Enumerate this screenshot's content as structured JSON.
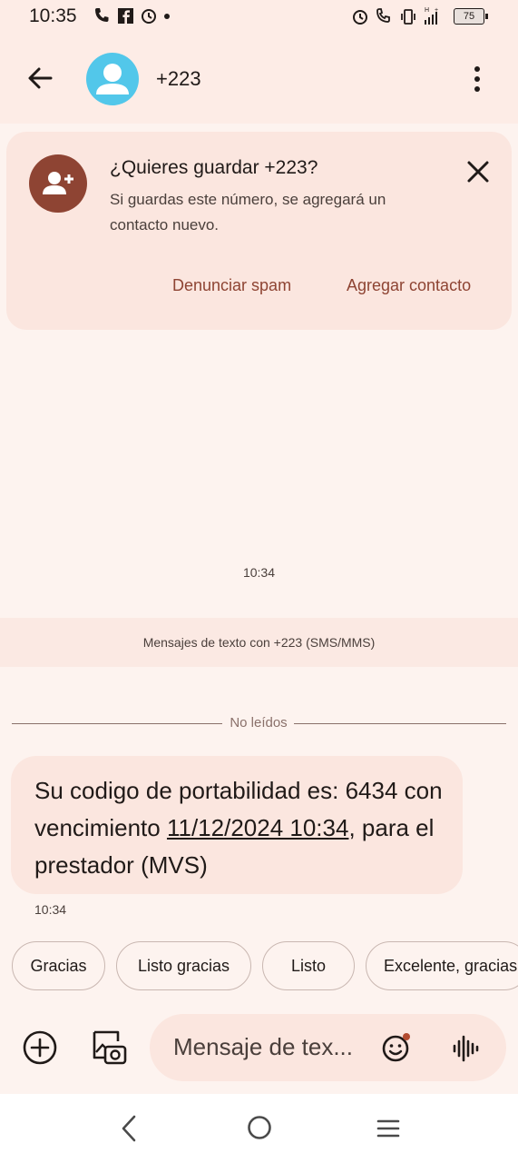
{
  "status_bar": {
    "time": "10:35",
    "battery": "75",
    "left_icons": [
      "phone-icon",
      "facebook-icon",
      "alarm-icon",
      "dot-icon"
    ],
    "right_icons": [
      "alarm-icon",
      "wifi-calling-icon",
      "vibrate-icon",
      "signal-icon",
      "battery-icon"
    ]
  },
  "app_bar": {
    "title": "+223",
    "back_icon": "arrow-back-icon",
    "more_icon": "more-vert-icon"
  },
  "save_card": {
    "title": "¿Quieres guardar +223?",
    "body": "Si guardas este número, se agregará un contacto nuevo.",
    "spam_label": "Denunciar spam",
    "add_label": "Agregar contacto"
  },
  "conversation": {
    "timestamp_top": "10:34",
    "info": "Mensajes de texto con +223 (SMS/MMS)",
    "unread_label": "No leídos",
    "message": {
      "prefix": "Su codigo de portabilidad es: 6434 con vencimiento ",
      "date": "11/12/2024 10:34",
      "suffix": ", para el prestador (MVS)",
      "time": "10:34"
    }
  },
  "suggestions": [
    "Gracias",
    "Listo gracias",
    "Listo",
    "Excelente, gracias"
  ],
  "compose": {
    "placeholder": "Mensaje de tex..."
  },
  "colors": {
    "accent": "#8e4433",
    "avatar": "#52c7ea",
    "background": "#fdf3ef",
    "surface": "#fbe6df"
  }
}
